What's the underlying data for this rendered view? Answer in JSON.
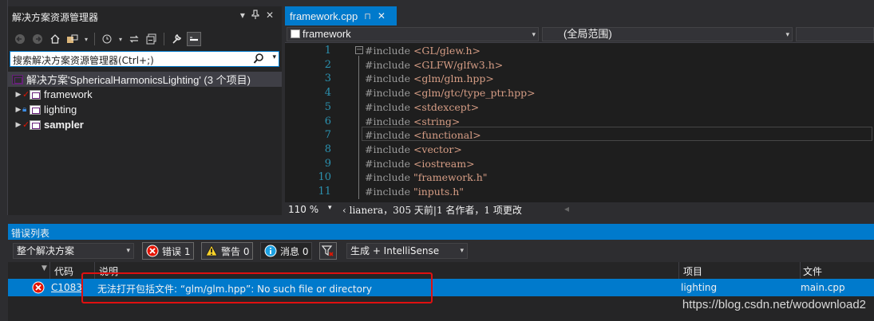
{
  "solution_explorer": {
    "title": "解决方案资源管理器",
    "pin_symbols": "▾ ₽ ✕",
    "search_placeholder": "搜索解决方案资源管理器(Ctrl+;)",
    "solution_label": "解决方案'SphericalHarmonicsLighting' (3 个项目)",
    "projects": [
      {
        "label": "framework",
        "bold": false
      },
      {
        "label": "lighting",
        "bold": false
      },
      {
        "label": "sampler",
        "bold": true
      }
    ]
  },
  "editor": {
    "tab_label": "framework.cpp",
    "nav_project": "framework",
    "nav_scope": "(全局范围)",
    "lines": [
      {
        "num": "1",
        "kw": "#include ",
        "inc": "<GL/glew.h>"
      },
      {
        "num": "2",
        "kw": "#include ",
        "inc": "<GLFW/glfw3.h>"
      },
      {
        "num": "3",
        "kw": "#include ",
        "inc": "<glm/glm.hpp>"
      },
      {
        "num": "4",
        "kw": "#include ",
        "inc": "<glm/gtc/type_ptr.hpp>"
      },
      {
        "num": "5",
        "kw": "#include ",
        "inc": "<stdexcept>"
      },
      {
        "num": "6",
        "kw": "#include ",
        "inc": "<string>"
      },
      {
        "num": "7",
        "kw": "#include ",
        "inc": "<functional>"
      },
      {
        "num": "8",
        "kw": "#include ",
        "inc": "<vector>"
      },
      {
        "num": "9",
        "kw": "#include ",
        "inc": "<iostream>"
      },
      {
        "num": "10",
        "kw": "#include ",
        "inc": "\"framework.h\""
      },
      {
        "num": "11",
        "kw": "#include ",
        "inc": "\"inputs.h\""
      }
    ],
    "zoom": "110 %",
    "git_info": "lianera，305 天前|1 名作者，1 项更改"
  },
  "error_list": {
    "title": "错误列表",
    "scope": "整个解决方案",
    "errors_label": "错误 1",
    "warnings_label": "警告 0",
    "messages_label": "消息 0",
    "build_filter": "生成 + IntelliSense",
    "columns": {
      "code": "代码",
      "desc": "说明",
      "project": "项目",
      "file": "文件"
    },
    "rows": [
      {
        "code": "C1083",
        "desc": "无法打开包括文件: “glm/glm.hpp”: No such file or directory",
        "project": "lighting",
        "file": "main.cpp"
      }
    ]
  },
  "watermark": "https://blog.csdn.net/wodownload2",
  "colors": {
    "accent": "#007acc",
    "highlight_box": "#e01010",
    "include_path": "#d69d85",
    "line_numbers": "#2b91af"
  }
}
